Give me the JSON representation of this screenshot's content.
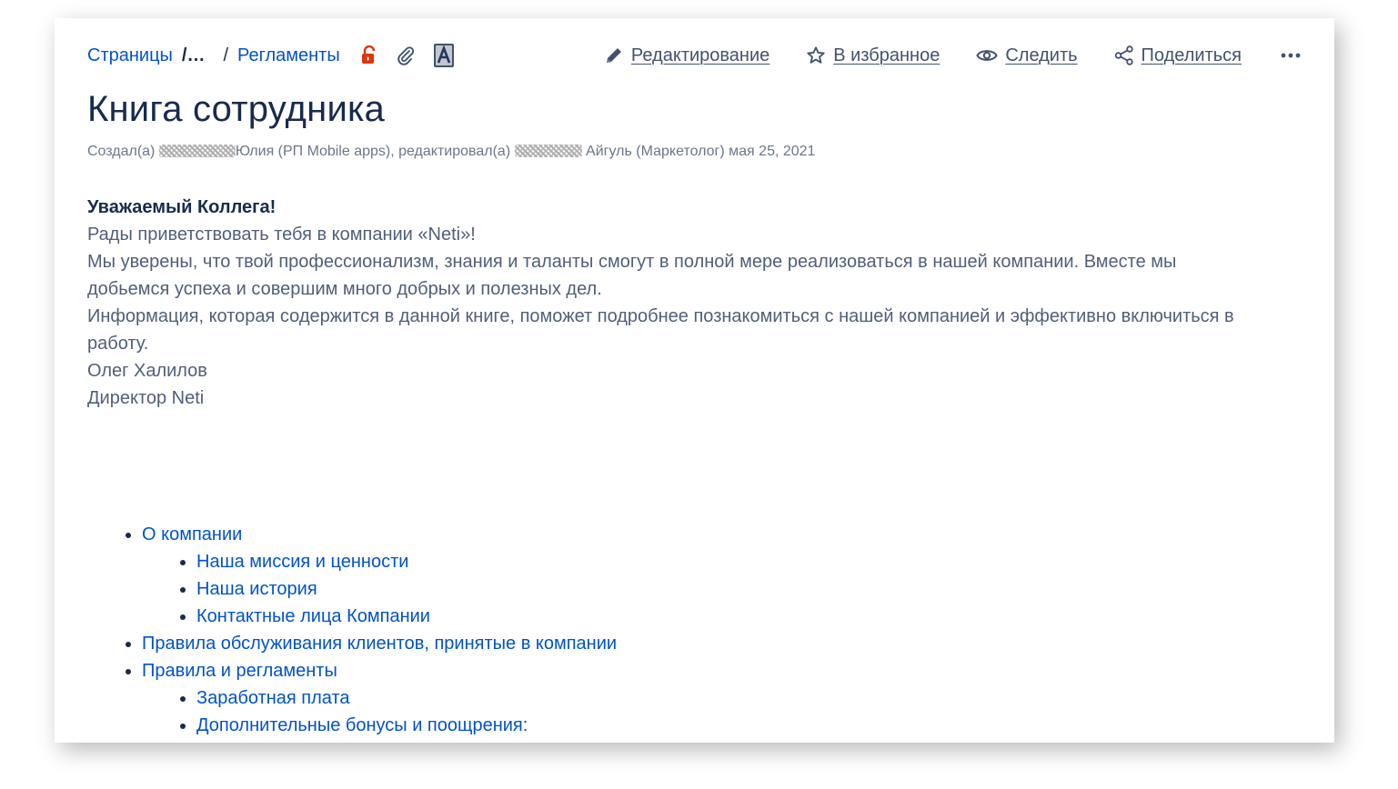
{
  "breadcrumb": {
    "root": "Страницы",
    "ellipsis": "/…",
    "separator": "/",
    "current": "Регламенты"
  },
  "page_icons": [
    "lock-open-icon",
    "paperclip-icon",
    "translate-a-icon"
  ],
  "actions": {
    "edit": "Редактирование",
    "favorite": "В избранное",
    "watch": "Следить",
    "share": "Поделиться",
    "more": "•••"
  },
  "page_title": "Книга сотрудника",
  "meta": {
    "created_prefix": "Создал(а)",
    "creator_name": "Юлия (РП Mobile apps), редактировал(а)",
    "editor_name": "Айгуль (Маркетолог) мая 25, 2021"
  },
  "content": {
    "greeting": "Уважаемый Коллега!",
    "lines": [
      "Рады приветствовать тебя в компании «Neti»!",
      "Мы уверены, что твой профессионализм, знания и таланты смогут в полной мере реализоваться в нашей компании. Вместе мы добьемся успеха и совершим много добрых и полезных дел.",
      "Информация, которая содержится в данной книге, поможет подробнее познакомиться с нашей компанией и эффективно включиться в работу."
    ],
    "signature_name": "Олег Халилов",
    "signature_title": "Директор Neti"
  },
  "toc": [
    {
      "label": "О компании",
      "children": [
        "Наша миссия и ценности",
        "Наша история",
        "Контактные лица Компании"
      ]
    },
    {
      "label": "Правила обслуживания клиентов, принятые в компании",
      "children": []
    },
    {
      "label": "Правила и регламенты",
      "children": [
        "Заработная плата",
        "Дополнительные бонусы и поощрения:"
      ]
    }
  ],
  "colors": {
    "link": "#0052cc",
    "title": "#172b4d",
    "text": "#505f79",
    "meta": "#6b778c",
    "lock": "#de350b"
  }
}
